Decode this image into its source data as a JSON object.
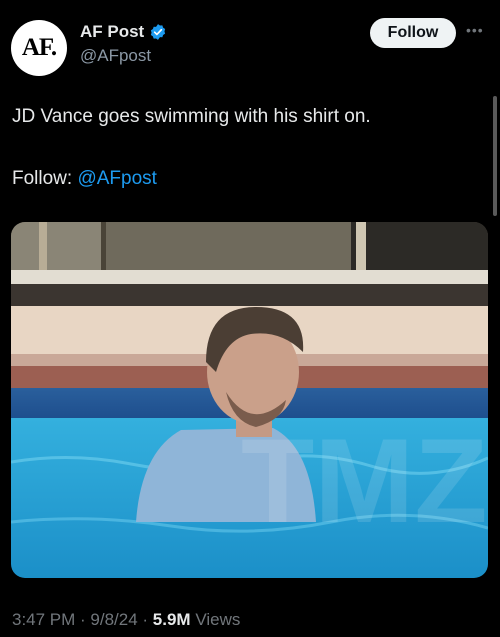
{
  "post": {
    "author_name": "AF Post",
    "handle": "@AFpost",
    "avatar_text": "AF.",
    "follow_button": "Follow",
    "more_icon": "•••",
    "text": "JD Vance goes swimming with his shirt on.",
    "follow_prefix": "Follow: ",
    "follow_link": "@AFpost",
    "time": "3:47 PM",
    "date": "9/8/24",
    "separator": " · ",
    "views_count": "5.9M",
    "views_label": " Views"
  },
  "colors": {
    "background": "#000000",
    "link": "#1d9bf0",
    "verified": "#1d9bf0",
    "muted": "#71767b"
  }
}
